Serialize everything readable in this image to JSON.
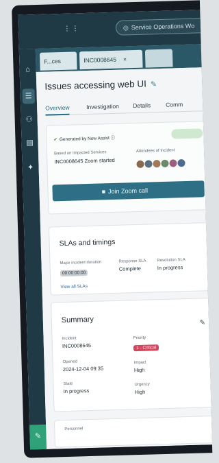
{
  "topbar": {
    "grid_icon": "grid-icon",
    "search_label": "Service Operations Wo"
  },
  "rail": {
    "icons": [
      "home-icon",
      "list-icon",
      "people-icon",
      "clipboard-icon",
      "pin-icon"
    ]
  },
  "tabs": [
    {
      "label": "F...ces"
    },
    {
      "label": "INC0008645",
      "close": "×"
    },
    {
      "label": ""
    }
  ],
  "page": {
    "title": "Issues accessing web UI",
    "subtabs": [
      "Overview",
      "Investigation",
      "Details",
      "Comm"
    ]
  },
  "zoom_card": {
    "generated": "Generated by Now Assist",
    "based_label": "Based on Impacted Services",
    "based_value": "INC0008645 Zoom started",
    "attendees_label": "Attendees of Incident",
    "join_button": "Join Zoom call"
  },
  "slas": {
    "title": "SLAs and timings",
    "items": [
      {
        "label": "Major incident duration",
        "value": "00:00:00:00",
        "chip": true
      },
      {
        "label": "Response SLA",
        "value": "Complete"
      },
      {
        "label": "Resolution SLA",
        "value": "In progress"
      }
    ],
    "view_all": "View all SLAs"
  },
  "summary": {
    "title": "Summary",
    "fields": [
      {
        "label": "Incident",
        "value": "INC0008645"
      },
      {
        "label": "Priority",
        "value": "1 - Critical",
        "priority": true
      },
      {
        "label": "Opened",
        "value": "2024-12-04 09:35"
      },
      {
        "label": "Impact",
        "value": "High"
      },
      {
        "label": "State",
        "value": "In progress"
      },
      {
        "label": "Urgency",
        "value": "High"
      }
    ]
  },
  "bottom_card": {
    "label": "Personnel"
  },
  "colors": {
    "chrome": "#1f3a45",
    "tabstrip": "#2a5866",
    "accent": "#2f6f85",
    "priority": "#d2475d",
    "success": "#2fa27a"
  }
}
